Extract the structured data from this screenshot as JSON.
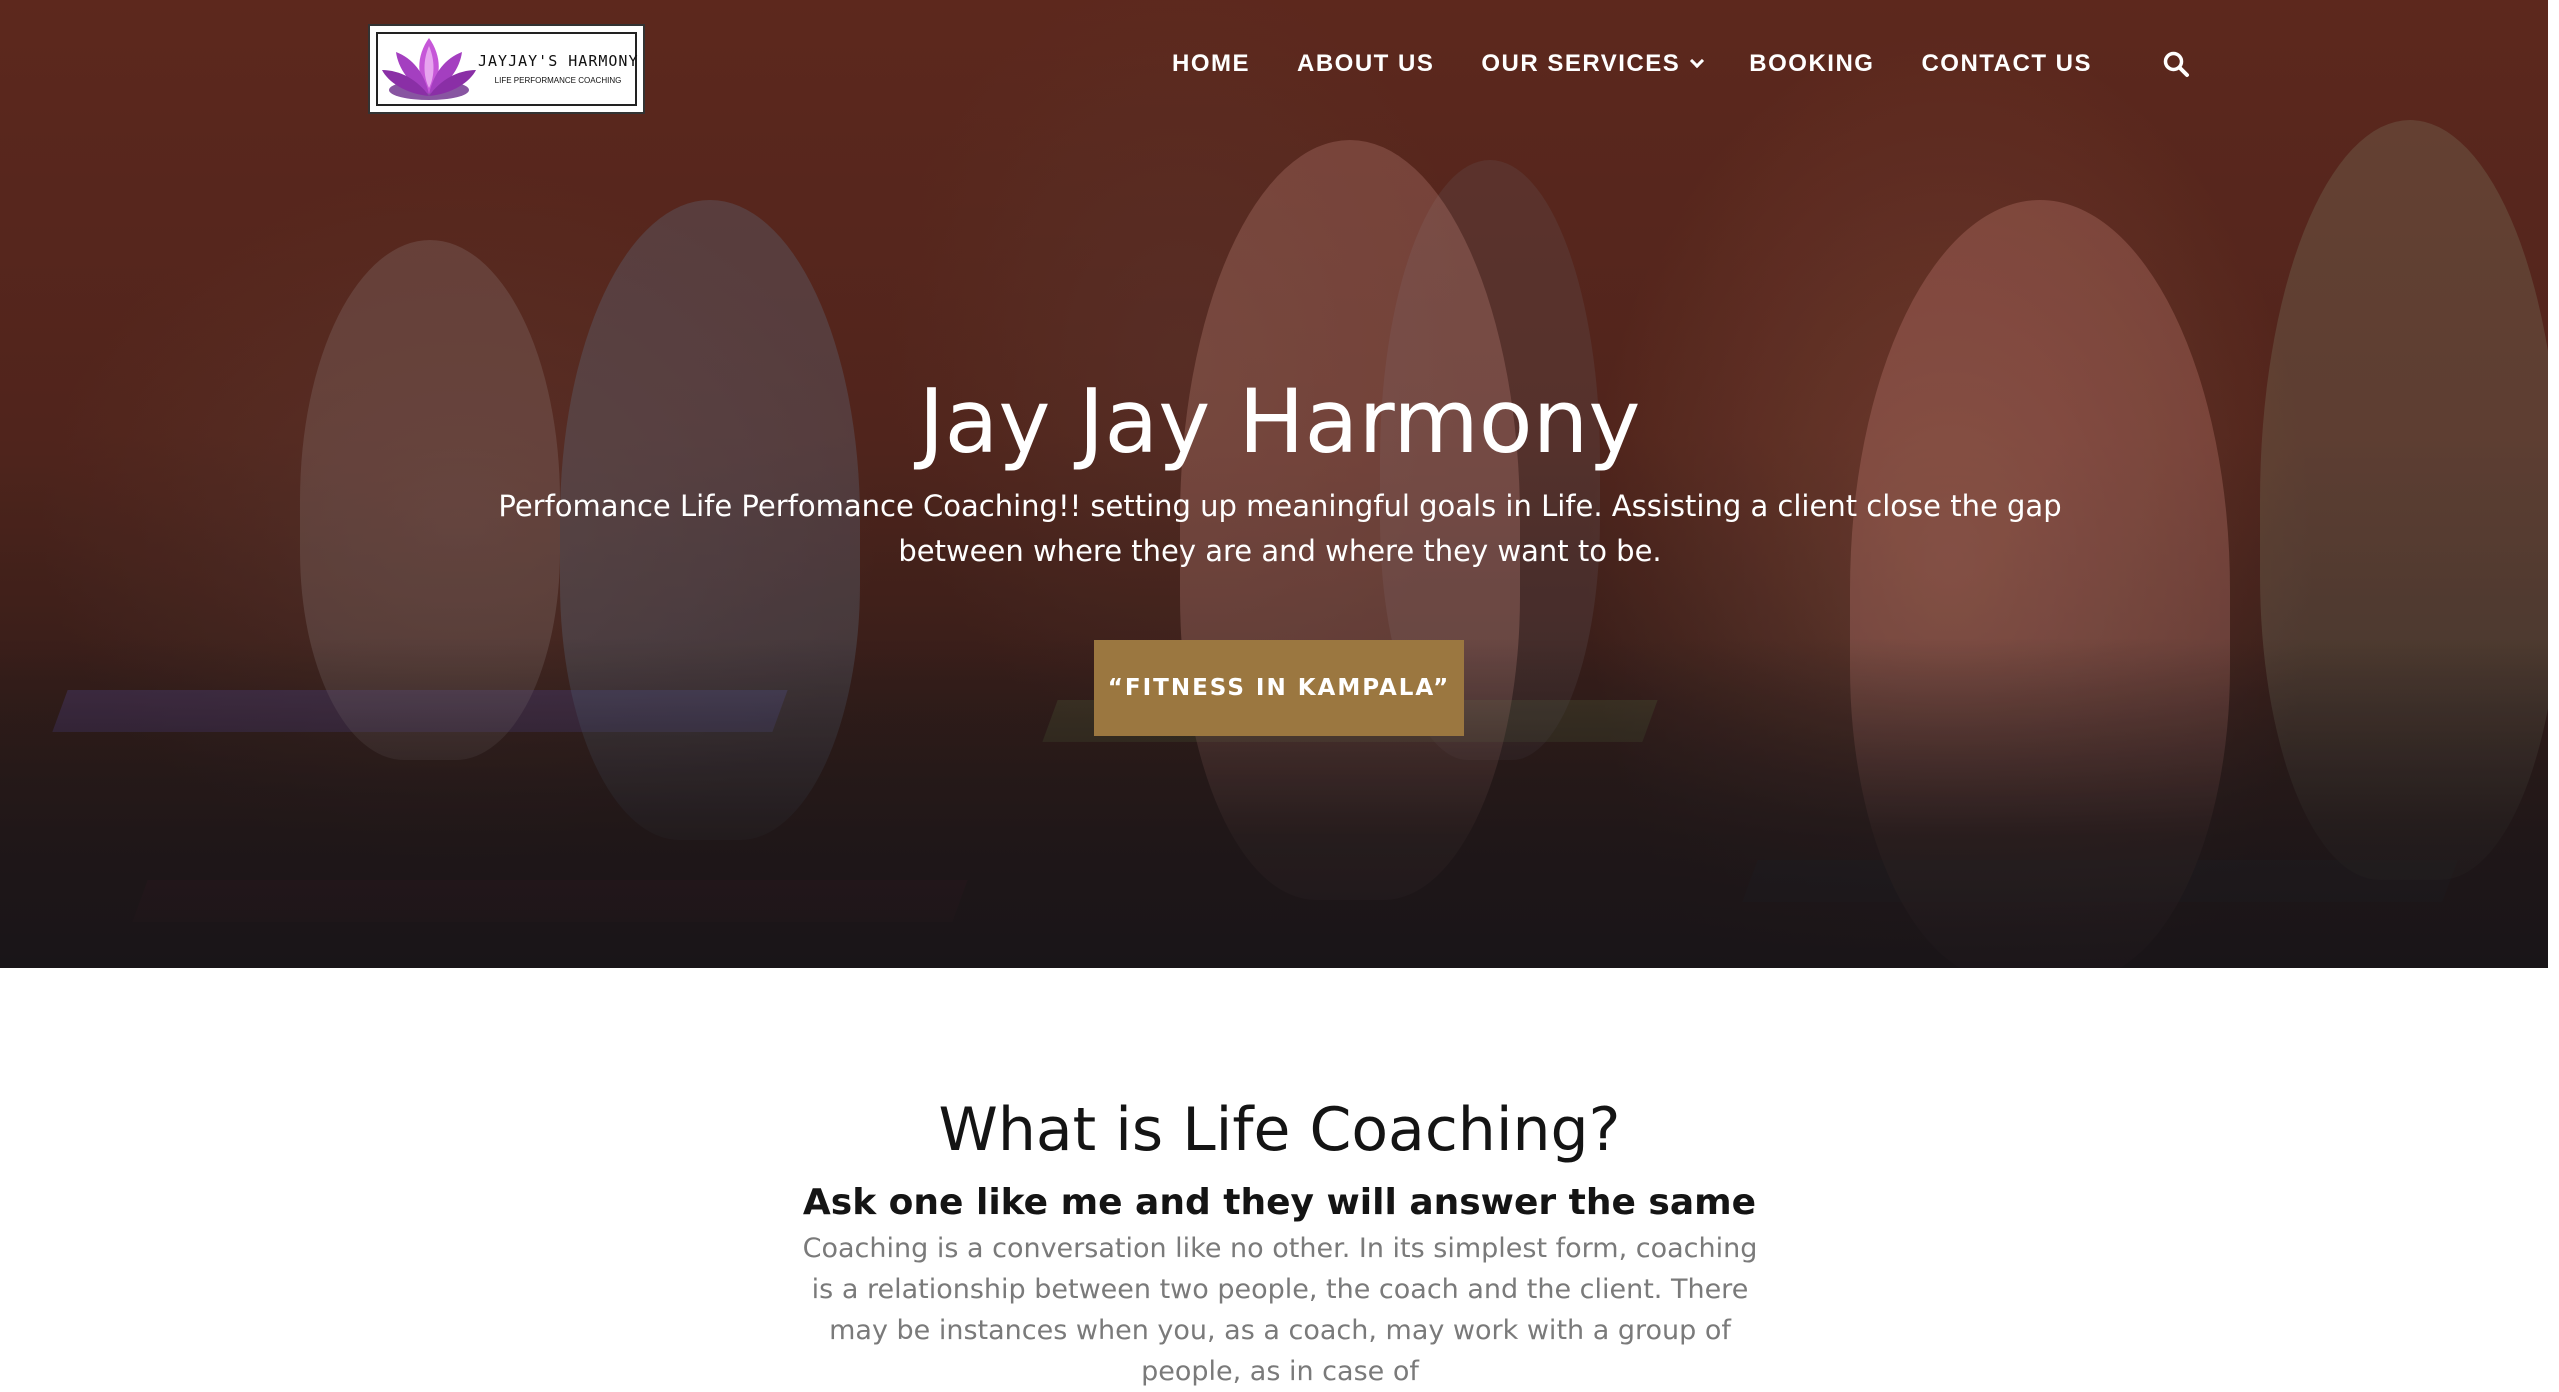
{
  "header": {
    "logo": {
      "name": "JAYJAY'S HARMONY",
      "tagline": "LIFE PERFORMANCE COACHING"
    },
    "nav": [
      {
        "label": "HOME"
      },
      {
        "label": "ABOUT US"
      },
      {
        "label": "OUR SERVICES",
        "has_dropdown": true
      },
      {
        "label": "BOOKING"
      },
      {
        "label": "CONTACT US"
      }
    ],
    "search_icon": "search-icon"
  },
  "hero": {
    "title": "Jay Jay Harmony",
    "subtitle": "Perfomance Life Perfomance Coaching!! setting up meaningful goals in Life. Assisting a client close the gap between where they are and where they want to be.",
    "cta_label": "“FITNESS IN KAMPALA”",
    "cta_color": "#9b7740"
  },
  "section": {
    "title": "What is Life Coaching?",
    "subtitle": "Ask one like me and they will answer the same",
    "body": "Coaching is a conversation like no other. In its simplest form, coaching is a relationship between two people, the coach and the client. There may be instances when you, as a coach, may work with a group of people, as in case of"
  },
  "colors": {
    "accent": "#9b7740",
    "text_dark": "#141414",
    "text_muted": "#7a7a7a"
  }
}
